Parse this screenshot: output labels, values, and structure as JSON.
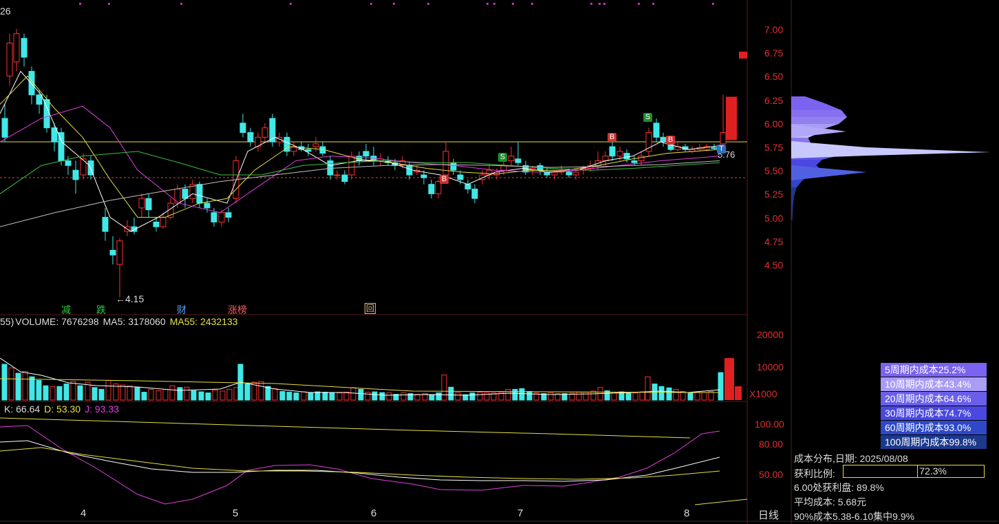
{
  "top_left_code": "26",
  "price_axis": [
    "7.00",
    "6.75",
    "6.50",
    "6.25",
    "6.00",
    "5.75",
    "5.50",
    "5.25",
    "5.00",
    "4.75",
    "4.50"
  ],
  "last_price_label": "5.76",
  "low_label": "←4.15",
  "events": [
    {
      "label": "减",
      "color": "#2ecc40"
    },
    {
      "label": "跌",
      "color": "#2ecc40"
    },
    {
      "label": "财",
      "color": "#4fa3ff"
    },
    {
      "label": "涨榜",
      "color": "#ff5a5a"
    },
    {
      "label": "回",
      "color": "#e0c080"
    }
  ],
  "signals": [
    "S",
    "B",
    "S",
    "B",
    "B",
    "T"
  ],
  "volume": {
    "prefix": "55)",
    "volume_label": "VOLUME: 7676298",
    "ma5_label": "MA5: 3178060",
    "ma55_label": "MA55: 2432133",
    "axis": [
      "20000",
      "10000"
    ],
    "unit": "X1000"
  },
  "kdj": {
    "k_label": "K: 66.64",
    "d_label": "D: 53.30",
    "j_label": "J: 93.33",
    "axis": [
      "100.00",
      "80.00",
      "50.00"
    ]
  },
  "months": [
    "4",
    "5",
    "6",
    "7",
    "8"
  ],
  "period_label": "日线",
  "cost_distribution": {
    "items": [
      {
        "label": "5周期内成本25.2%",
        "color": "#7b63f0"
      },
      {
        "label": "10周期内成本43.4%",
        "color": "#a89cf5"
      },
      {
        "label": "20周期内成本64.6%",
        "color": "#6a60e8"
      },
      {
        "label": "30周期内成本74.7%",
        "color": "#4a48e0"
      },
      {
        "label": "60周期内成本93.0%",
        "color": "#2e48c8"
      },
      {
        "label": "100周期内成本99.8%",
        "color": "#1c3a8c"
      }
    ],
    "date_label": "成本分布,日期:  2025/08/08",
    "profit_ratio_label": "获利比例:",
    "profit_ratio_value": "72.3%",
    "profit_ratio_fraction": 0.723,
    "profit_at_label": "6.00处获利盘:  89.8%",
    "avg_cost_label": "平均成本:  5.68元",
    "concentration_label": "90%成本5.38-6.10集中9.9%"
  },
  "colors": {
    "up": "#ff3030",
    "down": "#40e8e8",
    "ma5": "#ffffff",
    "ma10": "#e8e040",
    "ma20": "#e040e0",
    "ma30": "#40c040",
    "ma60": "#c0c0c0"
  }
}
